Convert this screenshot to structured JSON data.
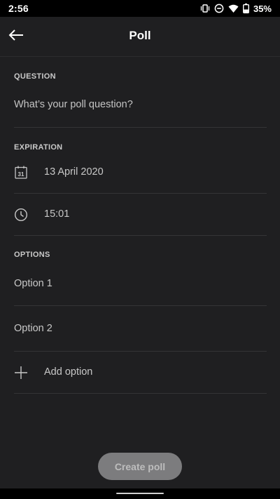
{
  "status_bar": {
    "time": "2:56",
    "battery": "35%",
    "icons": [
      "vibrate-icon",
      "do-not-disturb-icon",
      "wifi-icon",
      "battery-icon"
    ]
  },
  "app_bar": {
    "title": "Poll",
    "back_icon": "arrow-back-icon"
  },
  "question": {
    "label": "QUESTION",
    "placeholder": "What’s your poll question?"
  },
  "expiration": {
    "label": "EXPIRATION",
    "date": "13 April 2020",
    "date_icon": "calendar-icon",
    "date_icon_day": "31",
    "time": "15:01",
    "time_icon": "clock-icon"
  },
  "options": {
    "label": "OPTIONS",
    "items": [
      "Option 1",
      "Option 2"
    ],
    "add_label": "Add option",
    "add_icon": "plus-icon"
  },
  "footer": {
    "create_label": "Create poll"
  },
  "colors": {
    "background": "#1f1f21",
    "divider": "#343436",
    "button_disabled": "#7c7c7e"
  }
}
